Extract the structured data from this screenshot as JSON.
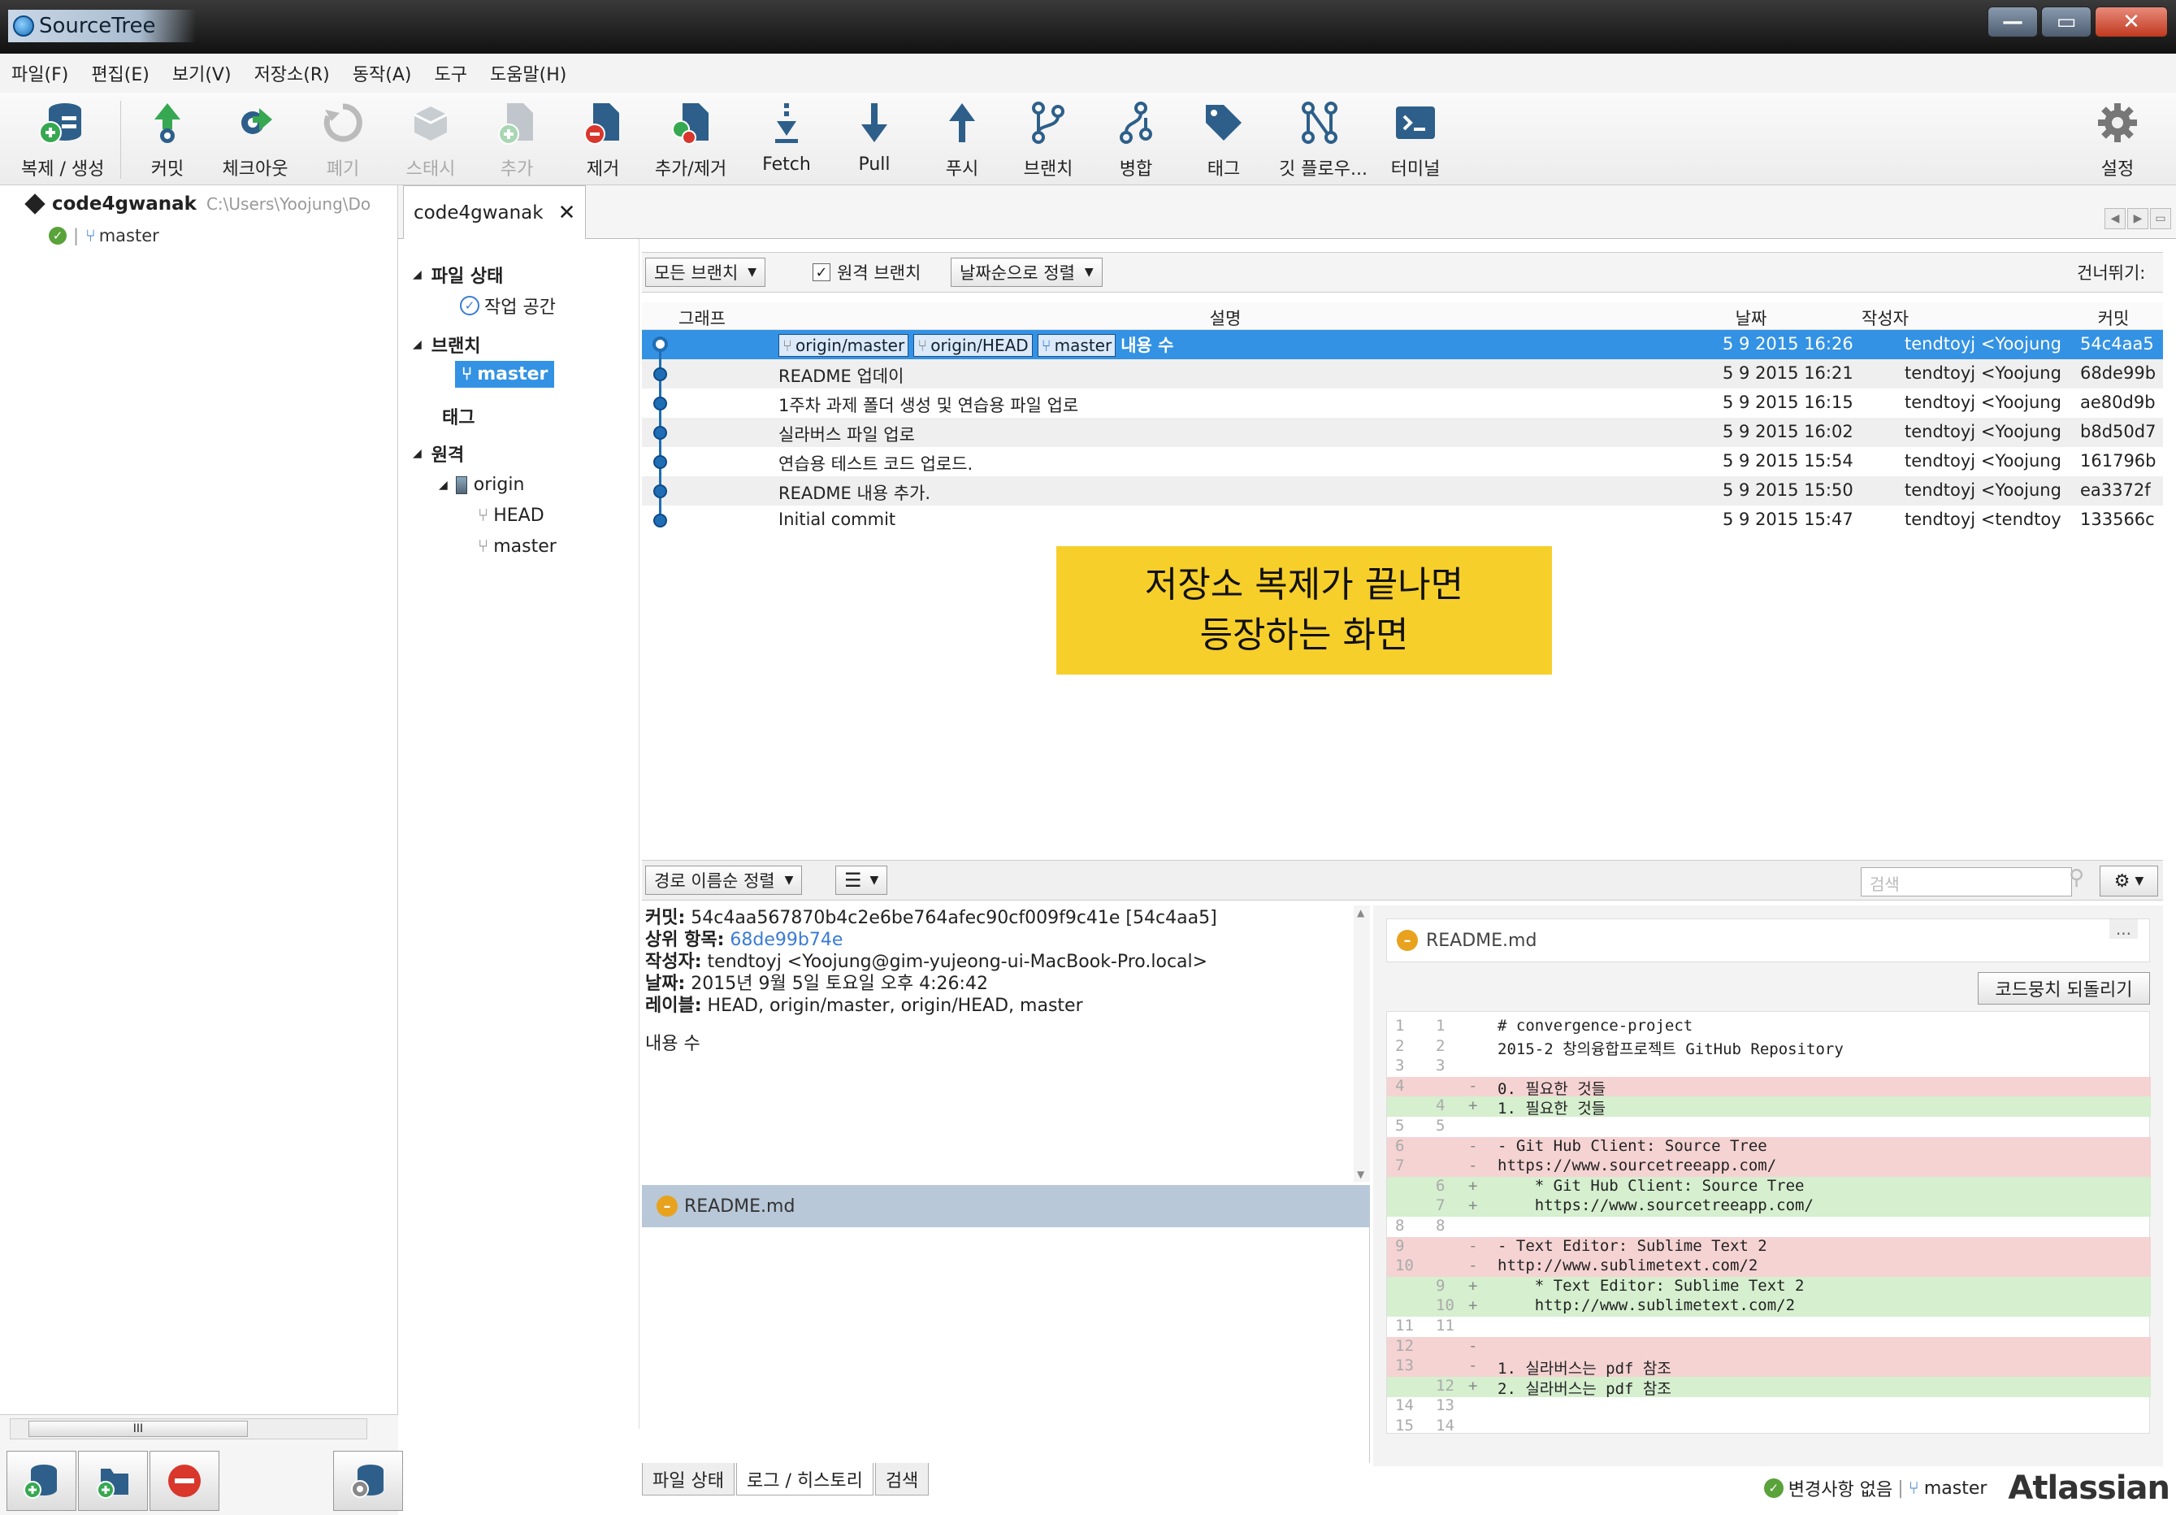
{
  "window": {
    "title": "SourceTree"
  },
  "menu": [
    "파일(F)",
    "편집(E)",
    "보기(V)",
    "저장소(R)",
    "동작(A)",
    "도구",
    "도움말(H)"
  ],
  "toolbar": {
    "clone": "복제 / 생성",
    "commit": "커밋",
    "checkout": "체크아웃",
    "discard": "폐기",
    "stash": "스태시",
    "add": "추가",
    "remove": "제거",
    "addremove": "추가/제거",
    "fetch": "Fetch",
    "pull": "Pull",
    "push": "푸시",
    "branch": "브랜치",
    "merge": "병합",
    "tag": "태그",
    "gitflow": "깃 플로우...",
    "terminal": "터미널",
    "settings": "설정"
  },
  "bookmark": {
    "name": "code4gwanak",
    "path": "C:\\Users\\Yoojung\\Do",
    "branch": "master"
  },
  "tab": {
    "label": "code4gwanak"
  },
  "tree": {
    "file_status": "파일 상태",
    "workspace": "작업 공간",
    "branches": "브랜치",
    "master": "master",
    "tags": "태그",
    "remotes": "원격",
    "origin": "origin",
    "head": "HEAD",
    "remote_master": "master"
  },
  "filter": {
    "all_branches": "모든 브랜치",
    "remote_branches": "원격 브랜치",
    "sort": "날짜순으로 정렬",
    "skip": "건너뛰기:"
  },
  "columns": {
    "graph": "그래프",
    "desc": "설명",
    "date": "날짜",
    "author": "작성자",
    "commit": "커밋"
  },
  "head_tags": [
    "origin/master",
    "origin/HEAD",
    "master"
  ],
  "commits": [
    {
      "desc": "내용 수",
      "date": "5 9 2015 16:26",
      "author": "tendtoyj <Yoojung",
      "hash": "54c4aa5"
    },
    {
      "desc": "README 업데이",
      "date": "5 9 2015 16:21",
      "author": "tendtoyj <Yoojung",
      "hash": "68de99b"
    },
    {
      "desc": "1주차 과제 폴더 생성 및 연습용 파일 업로",
      "date": "5 9 2015 16:15",
      "author": "tendtoyj <Yoojung",
      "hash": "ae80d9b"
    },
    {
      "desc": "실라버스 파일 업로",
      "date": "5 9 2015 16:02",
      "author": "tendtoyj <Yoojung",
      "hash": "b8d50d7"
    },
    {
      "desc": "연습용 테스트 코드 업로드.",
      "date": "5 9 2015 15:54",
      "author": "tendtoyj <Yoojung",
      "hash": "161796b"
    },
    {
      "desc": "README 내용 추가.",
      "date": "5 9 2015 15:50",
      "author": "tendtoyj <Yoojung",
      "hash": "ea3372f"
    },
    {
      "desc": "Initial commit",
      "date": "5 9 2015 15:47",
      "author": "tendtoyj <tendtoy",
      "hash": "133566c"
    }
  ],
  "note": {
    "line1": "저장소 복제가 끝나면",
    "line2": "등장하는 화면"
  },
  "lower": {
    "sort": "경로 이름순 정렬",
    "search_placeholder": "검색"
  },
  "details": {
    "commit_label": "커밋:",
    "commit_value": "54c4aa567870b4c2e6be764afec90cf009f9c41e [54c4aa5]",
    "parent_label": "상위 항목:",
    "parent_value": "68de99b74e",
    "author_label": "작성자:",
    "author_value": "tendtoyj <Yoojung@gim-yujeong-ui-MacBook-Pro.local>",
    "date_label": "날짜:",
    "date_value": "2015년 9월 5일 토요일 오후 4:26:42",
    "labels_label": "레이블:",
    "labels_value": "HEAD, origin/master, origin/HEAD, master",
    "message": "내용 수"
  },
  "file": {
    "name": "README.md"
  },
  "diff": {
    "filename": "README.md",
    "more": "...",
    "revert": "코드뭉치 되돌리기",
    "lines": [
      {
        "a": "1",
        "b": "1",
        "s": "",
        "t": "# convergence-project",
        "k": "ctx"
      },
      {
        "a": "2",
        "b": "2",
        "s": "",
        "t": "2015-2 창의융합프로젝트 GitHub Repository",
        "k": "ctx"
      },
      {
        "a": "3",
        "b": "3",
        "s": "",
        "t": "",
        "k": "ctx"
      },
      {
        "a": "4",
        "b": "",
        "s": "-",
        "t": "0. 필요한 것들",
        "k": "del"
      },
      {
        "a": "",
        "b": "4",
        "s": "+",
        "t": "1. 필요한 것들",
        "k": "add"
      },
      {
        "a": "5",
        "b": "5",
        "s": "",
        "t": "",
        "k": "ctx"
      },
      {
        "a": "6",
        "b": "",
        "s": "-",
        "t": "- Git Hub Client: Source Tree",
        "k": "del"
      },
      {
        "a": "7",
        "b": "",
        "s": "-",
        "t": "https://www.sourcetreeapp.com/",
        "k": "del"
      },
      {
        "a": "",
        "b": "6",
        "s": "+",
        "t": "    * Git Hub Client: Source Tree",
        "k": "add"
      },
      {
        "a": "",
        "b": "7",
        "s": "+",
        "t": "    https://www.sourcetreeapp.com/",
        "k": "add"
      },
      {
        "a": "8",
        "b": "8",
        "s": "",
        "t": "",
        "k": "ctx"
      },
      {
        "a": "9",
        "b": "",
        "s": "-",
        "t": "- Text Editor: Sublime Text 2",
        "k": "del"
      },
      {
        "a": "10",
        "b": "",
        "s": "-",
        "t": "http://www.sublimetext.com/2",
        "k": "del"
      },
      {
        "a": "",
        "b": "9",
        "s": "+",
        "t": "    * Text Editor: Sublime Text 2",
        "k": "add"
      },
      {
        "a": "",
        "b": "10",
        "s": "+",
        "t": "    http://www.sublimetext.com/2",
        "k": "add"
      },
      {
        "a": "11",
        "b": "11",
        "s": "",
        "t": "",
        "k": "ctx"
      },
      {
        "a": "12",
        "b": "",
        "s": "-",
        "t": "",
        "k": "del"
      },
      {
        "a": "13",
        "b": "",
        "s": "-",
        "t": "1. 실라버스는 pdf 참조",
        "k": "del"
      },
      {
        "a": "",
        "b": "12",
        "s": "+",
        "t": "2. 실라버스는 pdf 참조",
        "k": "add"
      },
      {
        "a": "14",
        "b": "13",
        "s": "",
        "t": "",
        "k": "ctx"
      },
      {
        "a": "15",
        "b": "14",
        "s": "",
        "t": "",
        "k": "ctx"
      }
    ]
  },
  "bottom_tabs": [
    "파일 상태",
    "로그 / 히스토리",
    "검색"
  ],
  "status": {
    "no_changes": "변경사항 없음",
    "branch": "master",
    "brand": "Atlassian"
  }
}
